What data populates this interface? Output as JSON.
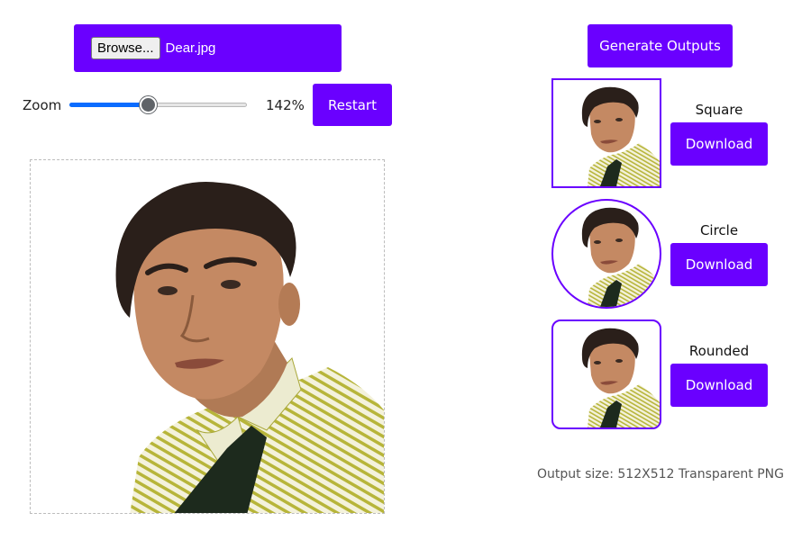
{
  "file": {
    "browse_label": "Browse...",
    "file_name": "Dear.jpg"
  },
  "zoom": {
    "label": "Zoom",
    "value_text": "142%",
    "fraction": 0.44
  },
  "restart_label": "Restart",
  "generate_label": "Generate Outputs",
  "outputs": [
    {
      "shape": "Square",
      "download_label": "Download"
    },
    {
      "shape": "Circle",
      "download_label": "Download"
    },
    {
      "shape": "Rounded",
      "download_label": "Download"
    }
  ],
  "output_info": "Output size: 512X512 Transparent PNG",
  "colors": {
    "accent": "#6a00ff",
    "slider_fill": "#0a6cff"
  }
}
